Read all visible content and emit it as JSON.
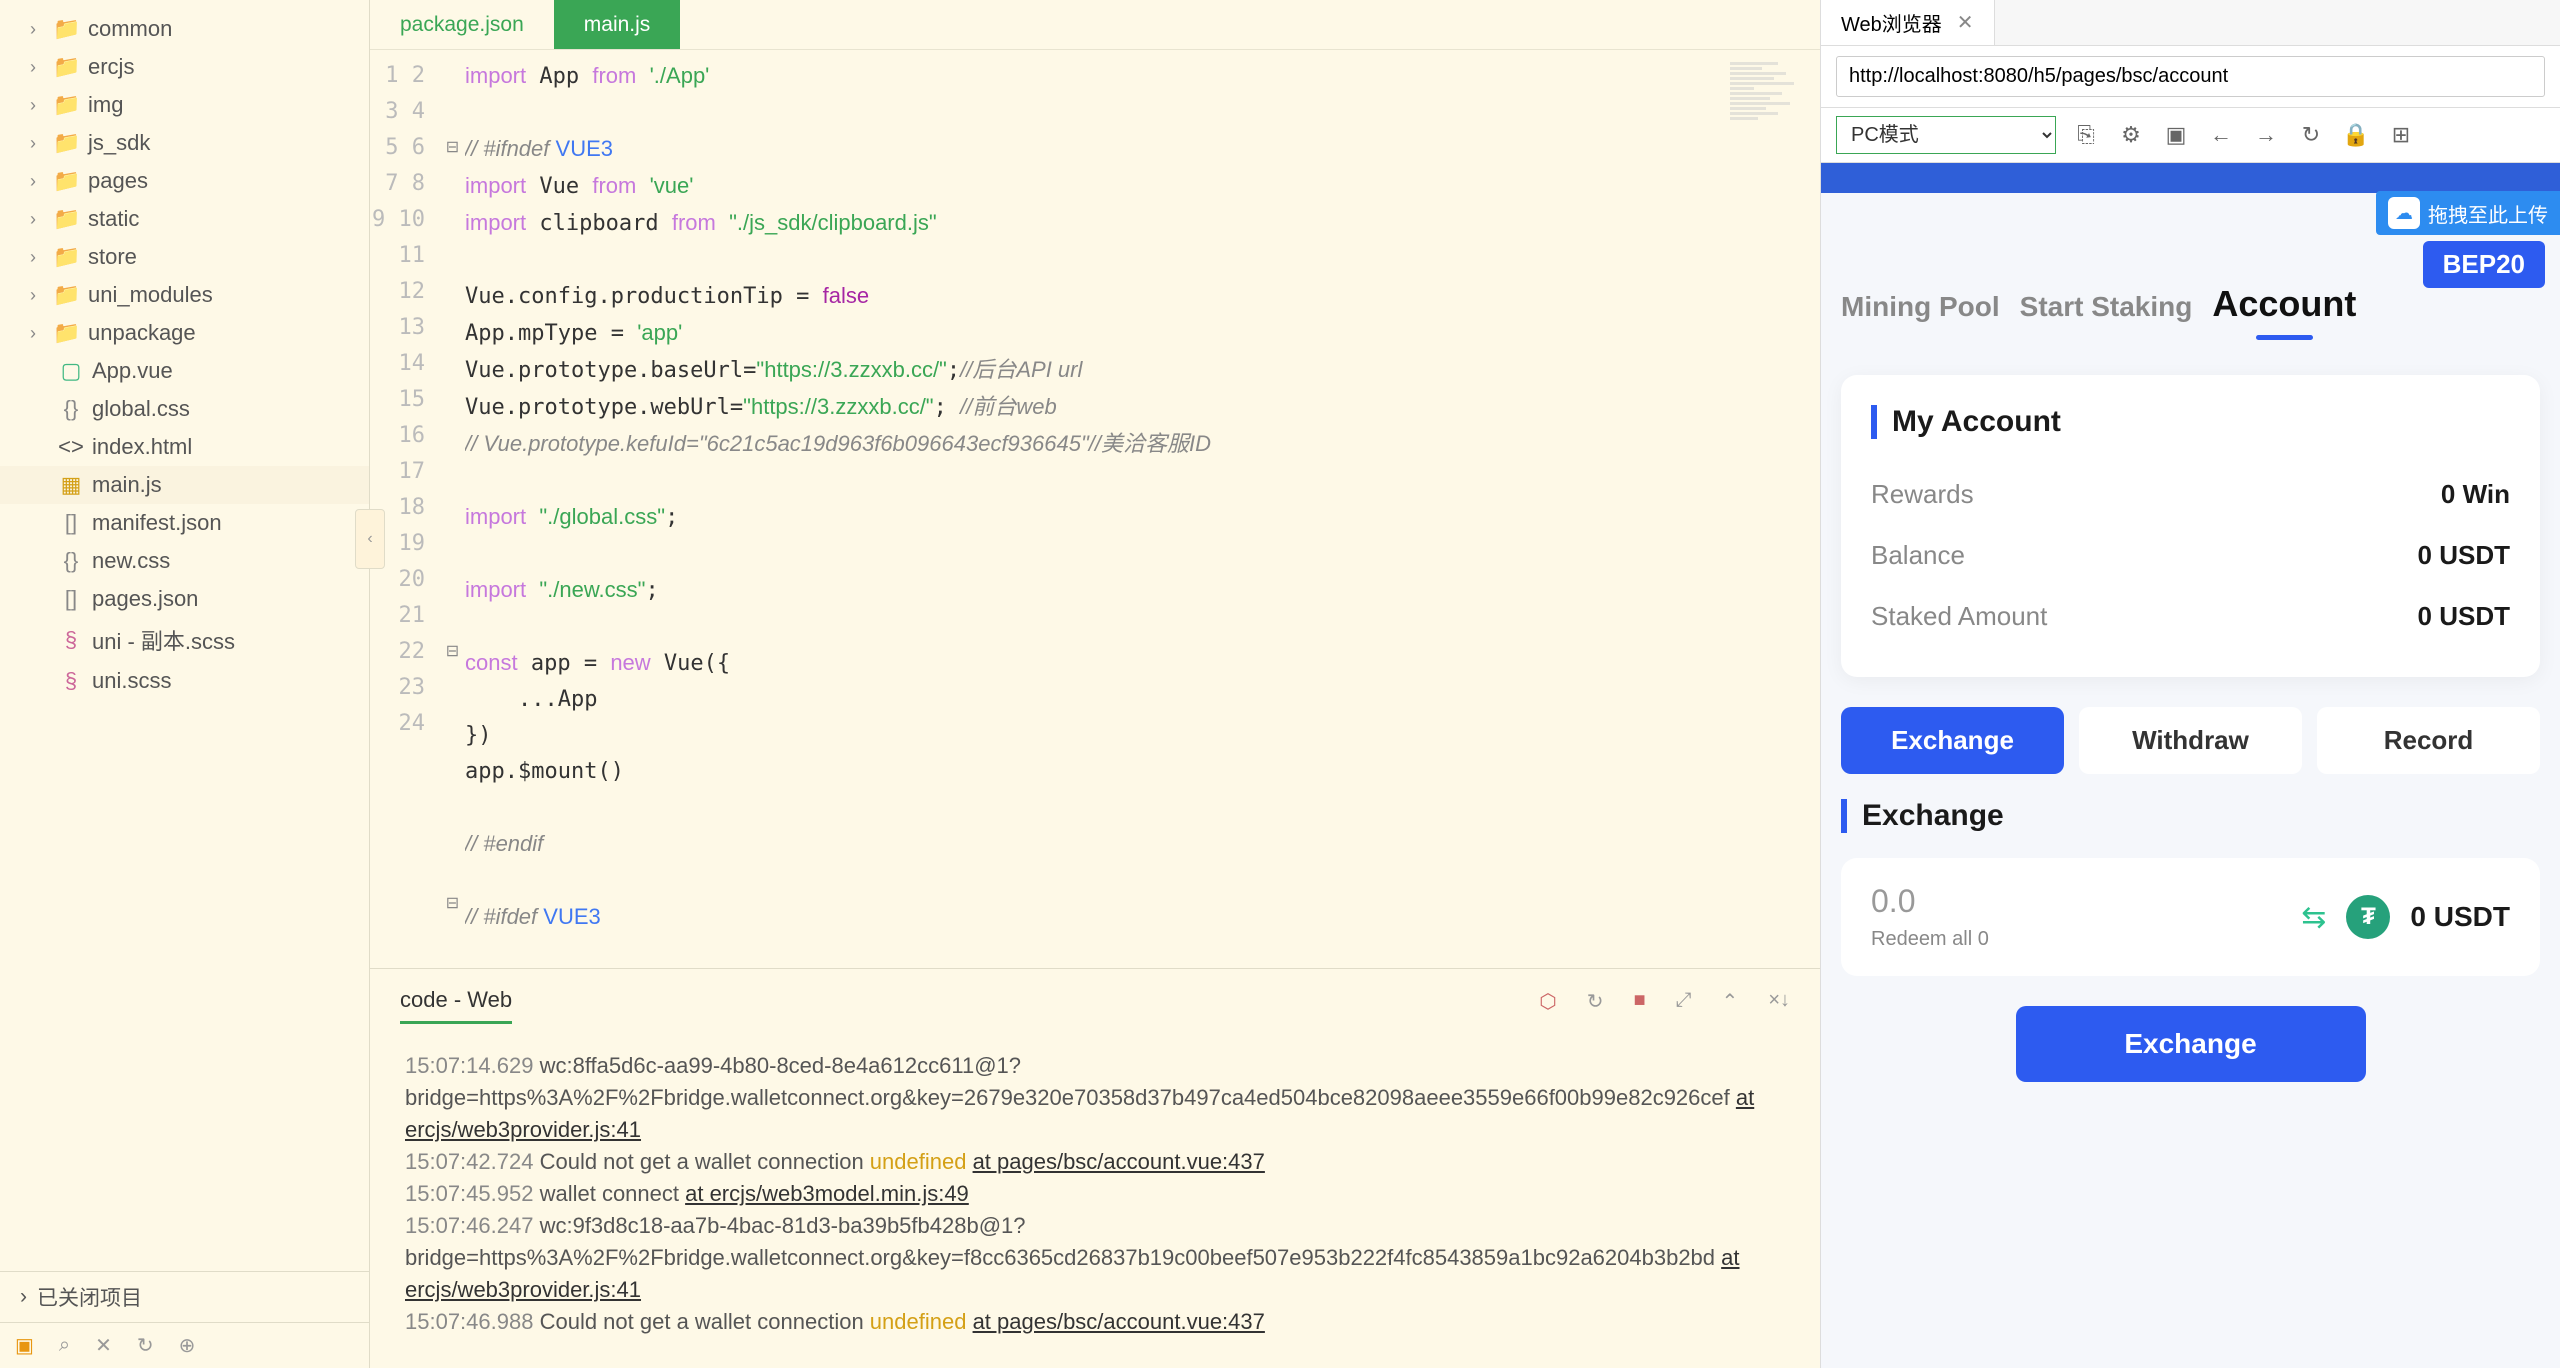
{
  "sidebar": {
    "folders": [
      {
        "name": "common"
      },
      {
        "name": "ercjs"
      },
      {
        "name": "img"
      },
      {
        "name": "js_sdk"
      },
      {
        "name": "pages"
      },
      {
        "name": "static"
      },
      {
        "name": "store"
      },
      {
        "name": "uni_modules"
      },
      {
        "name": "unpackage"
      }
    ],
    "files": [
      {
        "name": "App.vue",
        "type": "vue"
      },
      {
        "name": "global.css",
        "type": "css"
      },
      {
        "name": "index.html",
        "type": "html"
      },
      {
        "name": "main.js",
        "type": "js",
        "selected": true
      },
      {
        "name": "manifest.json",
        "type": "json"
      },
      {
        "name": "new.css",
        "type": "css"
      },
      {
        "name": "pages.json",
        "type": "json"
      },
      {
        "name": "uni - 副本.scss",
        "type": "scss"
      },
      {
        "name": "uni.scss",
        "type": "scss"
      }
    ],
    "closed_projects": "已关闭项目"
  },
  "tabs": {
    "items": [
      "package.json",
      "main.js"
    ],
    "active": "main.js"
  },
  "code": {
    "lines": [
      {
        "n": 1,
        "fold": "",
        "html": "<span class=\"kw\">import</span> App <span class=\"kw\">from</span> <span class=\"str\">'./App'</span>"
      },
      {
        "n": 2,
        "fold": "",
        "html": ""
      },
      {
        "n": 3,
        "fold": "⊟",
        "html": "<span class=\"cm\">// #ifndef </span><span class=\"id\">VUE3</span>"
      },
      {
        "n": 4,
        "fold": "",
        "html": "<span class=\"kw\">import</span> Vue <span class=\"kw\">from</span> <span class=\"str\">'vue'</span>"
      },
      {
        "n": 5,
        "fold": "",
        "html": "<span class=\"kw\">import</span> clipboard <span class=\"kw\">from</span> <span class=\"str\">\"./js_sdk/clipboard.js\"</span>"
      },
      {
        "n": 6,
        "fold": "",
        "html": ""
      },
      {
        "n": 7,
        "fold": "",
        "html": "Vue.config.productionTip = <span class=\"bool\">false</span>"
      },
      {
        "n": 8,
        "fold": "",
        "html": "App.mpType = <span class=\"str\">'app'</span>"
      },
      {
        "n": 9,
        "fold": "",
        "html": "Vue.prototype.baseUrl=<span class=\"str\">\"https://3.zzxxb.cc/\"</span>;<span class=\"cm\">//后台API url</span>"
      },
      {
        "n": 10,
        "fold": "",
        "html": "Vue.prototype.webUrl=<span class=\"str\">\"https://3.zzxxb.cc/\"</span>; <span class=\"cm\">//前台web</span>"
      },
      {
        "n": 11,
        "fold": "",
        "html": "<span class=\"cm\">// Vue.prototype.kefuId=\"6c21c5ac19d963f6b096643ecf936645\"//美洽客服ID</span>"
      },
      {
        "n": 12,
        "fold": "",
        "html": ""
      },
      {
        "n": 13,
        "fold": "",
        "html": "<span class=\"kw\">import</span> <span class=\"str\">\"./global.css\"</span>;"
      },
      {
        "n": 14,
        "fold": "",
        "html": ""
      },
      {
        "n": 15,
        "fold": "",
        "html": "<span class=\"kw\">import</span> <span class=\"str\">\"./new.css\"</span>;"
      },
      {
        "n": 16,
        "fold": "",
        "html": ""
      },
      {
        "n": 17,
        "fold": "⊟",
        "html": "<span class=\"kw\">const</span> app = <span class=\"kw\">new</span> Vue({"
      },
      {
        "n": 18,
        "fold": "",
        "html": "    ...App"
      },
      {
        "n": 19,
        "fold": "",
        "html": "})"
      },
      {
        "n": 20,
        "fold": "",
        "html": "app.$mount()"
      },
      {
        "n": 21,
        "fold": "",
        "html": ""
      },
      {
        "n": 22,
        "fold": "",
        "html": "<span class=\"cm\">// #endif</span>"
      },
      {
        "n": 23,
        "fold": "",
        "html": ""
      },
      {
        "n": 24,
        "fold": "⊟",
        "html": "<span class=\"cm\">// #ifdef </span><span class=\"id\">VUE3</span>"
      }
    ]
  },
  "console": {
    "tab": "code - Web",
    "lines": [
      {
        "ts": "15:07:14.629",
        "text": "wc:8ffa5d6c-aa99-4b80-8ced-8e4a612cc611@1?bridge=https%3A%2F%2Fbridge.walletconnect.org&key=2679e320e70358d37b497ca4ed504bce82098aeee3559e66f00b99e82c926cef ",
        "link": "at ercjs/web3provider.js:41"
      },
      {
        "ts": "15:07:42.724",
        "text": "Could not get a wallet connection ",
        "warn": "undefined ",
        "link": "at pages/bsc/account.vue:437"
      },
      {
        "ts": "15:07:45.952",
        "text": "wallet connect ",
        "link": "at ercjs/web3model.min.js:49"
      },
      {
        "ts": "15:07:46.247",
        "text": "wc:9f3d8c18-aa7b-4bac-81d3-ba39b5fb428b@1?bridge=https%3A%2F%2Fbridge.walletconnect.org&key=f8cc6365cd26837b19c00beef507e953b222f4fc8543859a1bc92a6204b3b2bd ",
        "link": "at ercjs/web3provider.js:41"
      },
      {
        "ts": "15:07:46.988",
        "text": "Could not get a wallet connection ",
        "warn": "undefined ",
        "link": "at pages/bsc/account.vue:437"
      }
    ]
  },
  "browser": {
    "tab_title": "Web浏览器",
    "url": "http://localhost:8080/h5/pages/bsc/account",
    "mode": "PC模式",
    "drag_hint": "拖拽至此上传",
    "bep_badge": "BEP20",
    "nav_tabs": [
      "Mining Pool",
      "Start Staking",
      "Account"
    ],
    "account": {
      "title": "My Account",
      "rows": [
        {
          "label": "Rewards",
          "value": "0 Win"
        },
        {
          "label": "Balance",
          "value": "0 USDT"
        },
        {
          "label": "Staked Amount",
          "value": "0 USDT"
        }
      ]
    },
    "action_tabs": [
      "Exchange",
      "Withdraw",
      "Record"
    ],
    "exchange": {
      "title": "Exchange",
      "amount": "0.0",
      "redeem": "Redeem all 0",
      "usdt_value": "0 USDT",
      "button": "Exchange"
    }
  }
}
